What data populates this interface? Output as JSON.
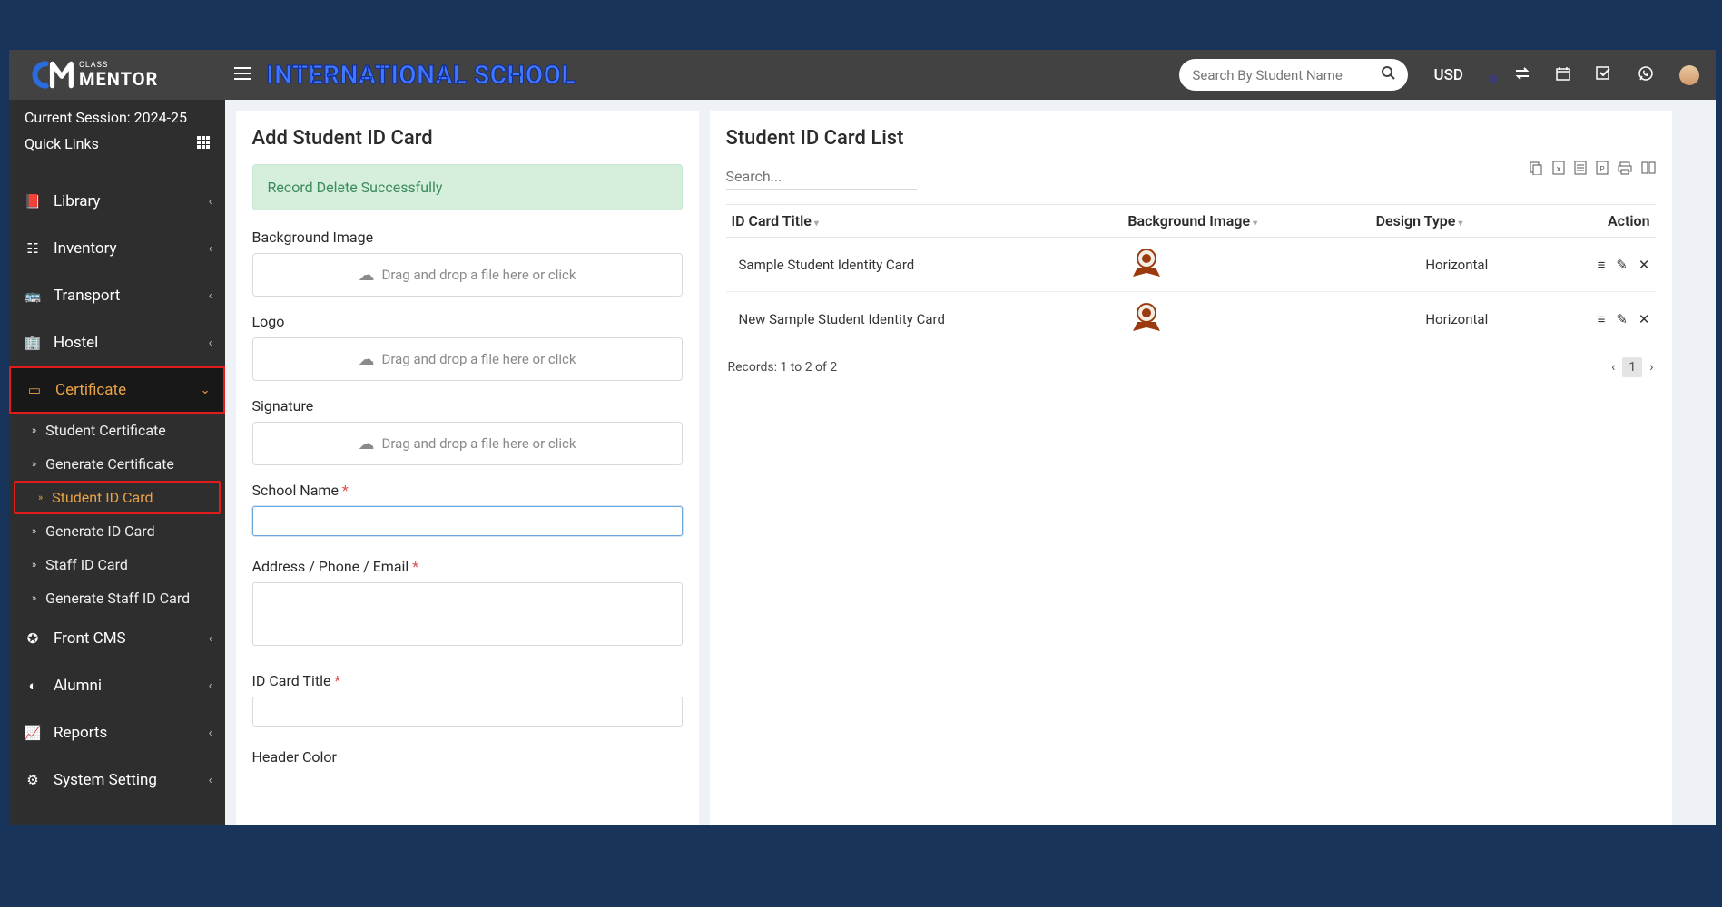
{
  "brand": {
    "class": "CLASS",
    "mentor": "MENTOR"
  },
  "navbar": {
    "school_title": "INTERNATIONAL SCHOOL",
    "search_placeholder": "Search By Student Name",
    "currency": "USD"
  },
  "sidebar": {
    "session_label": "Current Session: 2024-25",
    "quick_links": "Quick Links",
    "items": [
      {
        "label": "Library"
      },
      {
        "label": "Inventory"
      },
      {
        "label": "Transport"
      },
      {
        "label": "Hostel"
      },
      {
        "label": "Certificate"
      },
      {
        "label": "Front CMS"
      },
      {
        "label": "Alumni"
      },
      {
        "label": "Reports"
      },
      {
        "label": "System Setting"
      }
    ],
    "cert_sub": [
      {
        "label": "Student Certificate"
      },
      {
        "label": "Generate Certificate"
      },
      {
        "label": "Student ID Card"
      },
      {
        "label": "Generate ID Card"
      },
      {
        "label": "Staff ID Card"
      },
      {
        "label": "Generate Staff ID Card"
      }
    ]
  },
  "form": {
    "title": "Add Student ID Card",
    "alert": "Record Delete Successfully",
    "bg_label": "Background Image",
    "logo_label": "Logo",
    "sig_label": "Signature",
    "drop_text": "Drag and drop a file here or click",
    "school_label": "School Name",
    "addr_label": "Address / Phone / Email",
    "idtitle_label": "ID Card Title",
    "header_color_label": "Header Color"
  },
  "list": {
    "title": "Student ID Card List",
    "search_placeholder": "Search...",
    "cols": {
      "title": "ID Card Title",
      "bg": "Background Image",
      "design": "Design Type",
      "action": "Action"
    },
    "rows": [
      {
        "title": "Sample Student Identity Card",
        "design": "Horizontal"
      },
      {
        "title": "New Sample Student Identity Card",
        "design": "Horizontal"
      }
    ],
    "records": "Records: 1 to 2 of 2",
    "page": "1"
  }
}
